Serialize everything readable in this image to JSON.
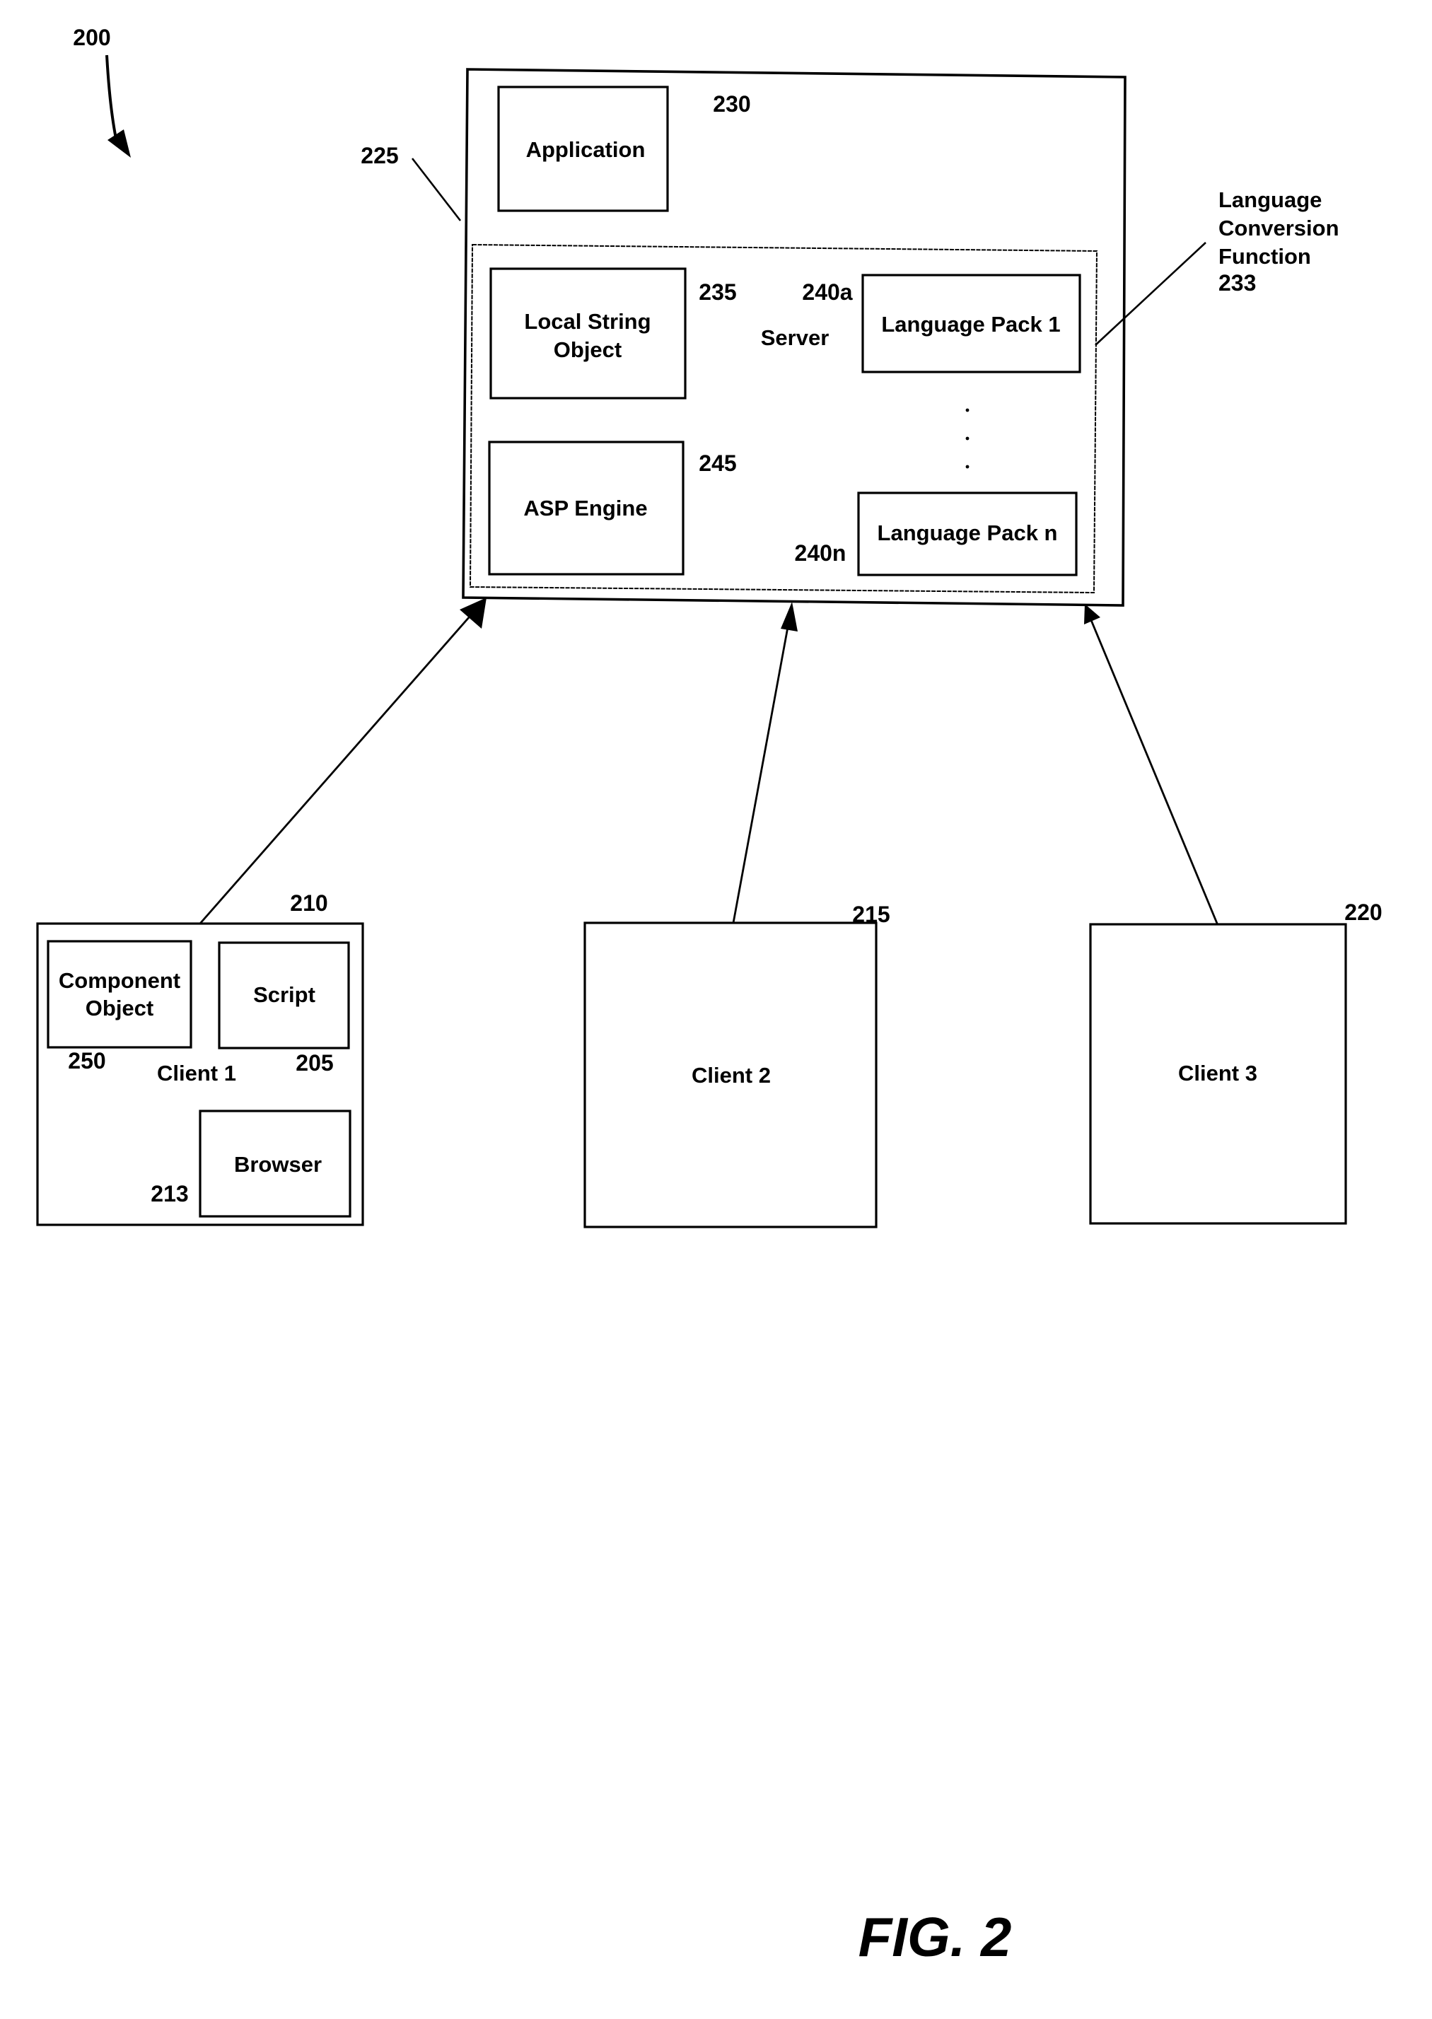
{
  "figure": {
    "ref_number": "200",
    "caption": "FIG. 2"
  },
  "server": {
    "ref_number": "225",
    "label": "Server",
    "application": {
      "label": "Application",
      "ref_number": "230"
    },
    "local_string_object": {
      "label_lines": [
        "Local String",
        "Object"
      ],
      "ref_number": "235"
    },
    "asp_engine": {
      "label": "ASP Engine",
      "ref_number": "245"
    },
    "language_packs": [
      {
        "label": "Language Pack 1",
        "ref_number": "240a"
      },
      {
        "label": "Language Pack n",
        "ref_number": "240n"
      }
    ],
    "ellipsis": "⋮",
    "language_conversion_function": {
      "label_lines": [
        "Language",
        "Conversion",
        "Function"
      ],
      "ref_number": "233"
    }
  },
  "clients": [
    {
      "label": "Client 1",
      "ref_number": "210",
      "components": [
        {
          "label_lines": [
            "Component",
            "Object"
          ],
          "ref_number": "250"
        },
        {
          "label": "Script",
          "ref_number": "205"
        },
        {
          "label": "Browser",
          "ref_number": "213"
        }
      ]
    },
    {
      "label": "Client 2",
      "ref_number": "215"
    },
    {
      "label": "Client 3",
      "ref_number": "220"
    }
  ],
  "connections": [
    {
      "from": "Client 1",
      "to": "Server"
    },
    {
      "from": "Client 2",
      "to": "Server"
    },
    {
      "from": "Client 3",
      "to": "Server"
    }
  ]
}
